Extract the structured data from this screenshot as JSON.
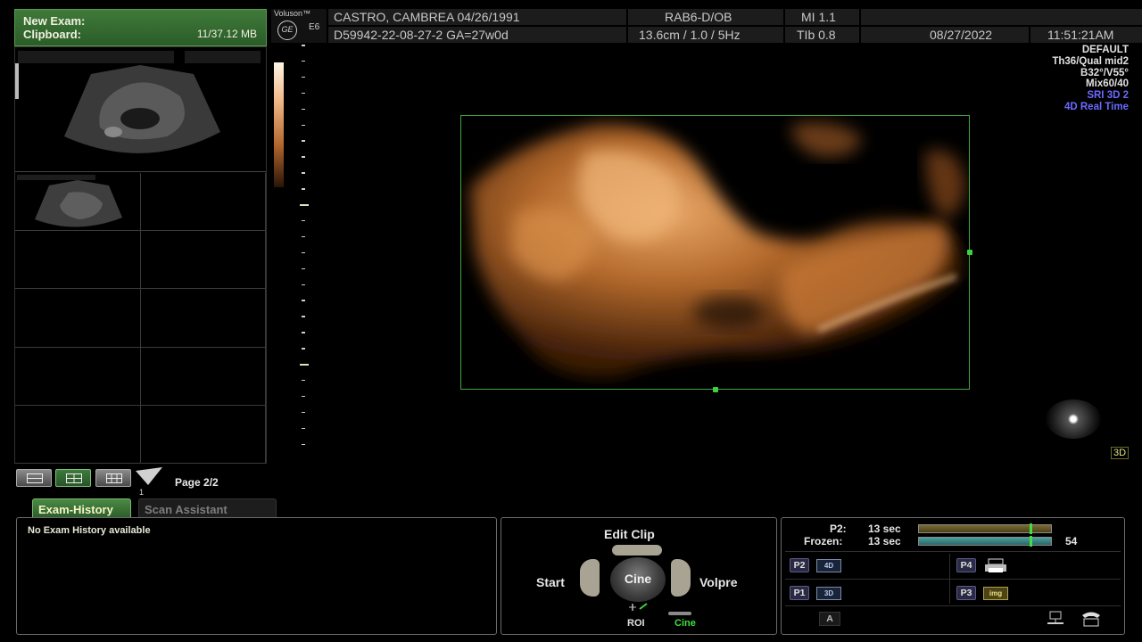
{
  "clipboard": {
    "new_exam_label": "New Exam:",
    "clipboard_label": "Clipboard:",
    "size": "11/37.12 MB"
  },
  "system": {
    "brand": "Voluson™",
    "model": "E6",
    "logo": "GE"
  },
  "header": {
    "patient": "CASTRO, CAMBREA 04/26/1991",
    "probe": "RAB6-D/OB",
    "mi": "MI 1.1",
    "exam_id": "D59942-22-08-27-2 GA=27w0d",
    "scan_params": "13.6cm / 1.0 / 5Hz",
    "tib": "TIb 0.8",
    "date": "08/27/2022",
    "time": "11:51:21AM"
  },
  "right_params": {
    "preset": "DEFAULT",
    "quality": "Th36/Qual mid2",
    "angles": "B32°/V55°",
    "mix": "Mix60/40",
    "sri": "SRI 3D 2",
    "mode": "4D Real Time"
  },
  "render": {
    "tag": "3D"
  },
  "layout_bar": {
    "page": "Page 2/2",
    "marker": "1"
  },
  "tabs": {
    "exam_history": "Exam-History",
    "scan_assistant": "Scan Assistant"
  },
  "exam_history": {
    "message": "No Exam History available"
  },
  "cine": {
    "edit_clip": "Edit Clip",
    "start": "Start",
    "cine": "Cine",
    "volpre": "Volpre",
    "roi": "ROI",
    "cine_small": "Cine"
  },
  "status": {
    "p2_label": "P2:",
    "p2_value": "13 sec",
    "frozen_label": "Frozen:",
    "frozen_value": "13 sec",
    "frame_count": "54",
    "keys": {
      "p2": "P2",
      "p2_icon": "4D",
      "p4": "P4",
      "p1": "P1",
      "p1_icon": "3D",
      "p3": "P3",
      "p3_icon": "img",
      "a": "A"
    }
  },
  "colors": {
    "accent_green": "#3fa53f",
    "sri_blue": "#6a6aff",
    "render_orange": "#c97a3a"
  }
}
